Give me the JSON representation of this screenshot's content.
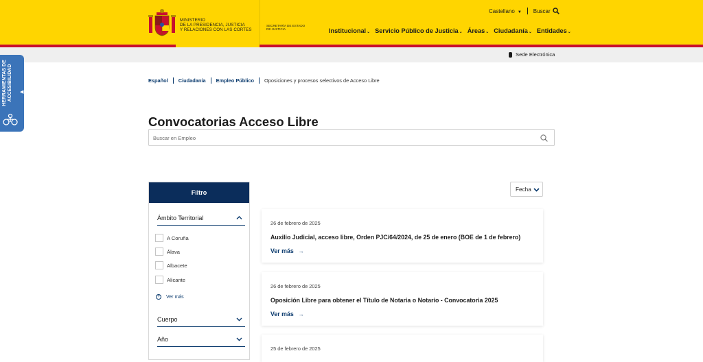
{
  "header": {
    "ministry_lines": [
      "Ministerio",
      "de la Presidencia, Justicia",
      "y Relaciones con las Cortes"
    ],
    "secretaria_lines": [
      "Secretaría de Estado",
      "de Justicia"
    ],
    "language": "Castellano",
    "search_label": "Buscar",
    "nav": [
      "Institucional",
      "Servicio Público de Justicia",
      "Áreas",
      "Ciudadanía",
      "Entidades"
    ],
    "sede": "Sede Electrónica",
    "colors": {
      "brand_yellow": "#ffd500",
      "brand_red": "#c8102e",
      "navy": "#0b2d5b"
    }
  },
  "accessibility": {
    "lines": [
      "Herramientas de",
      "accesibilidad"
    ]
  },
  "breadcrumb": [
    "Español",
    "Ciudadanía",
    "Empleo Público",
    "Oposiciones y procesos selectivos de Acceso Libre"
  ],
  "page": {
    "title": "Convocatorias Acceso Libre",
    "search_placeholder": "Buscar en Empleo"
  },
  "filter": {
    "title": "Filtro",
    "sections": [
      "Ámbito Territorial",
      "Cuerpo",
      "Año"
    ],
    "options": [
      "A Coruña",
      "Álava",
      "Albacete",
      "Alicante"
    ],
    "see_more": "Ver más"
  },
  "sort": {
    "label": "Fecha"
  },
  "results": [
    {
      "date": "26 de febrero de 2025",
      "title": "Auxilio Judicial, acceso libre, Orden PJC/64/2024, de 25 de enero (BOE de 1 de febrero)",
      "more": "Ver más"
    },
    {
      "date": "26 de febrero de 2025",
      "title": "Oposición Libre para obtener el Título de Notaria o Notario - Convocatoria 2025",
      "more": "Ver más"
    },
    {
      "date": "25 de febrero de 2025"
    }
  ]
}
